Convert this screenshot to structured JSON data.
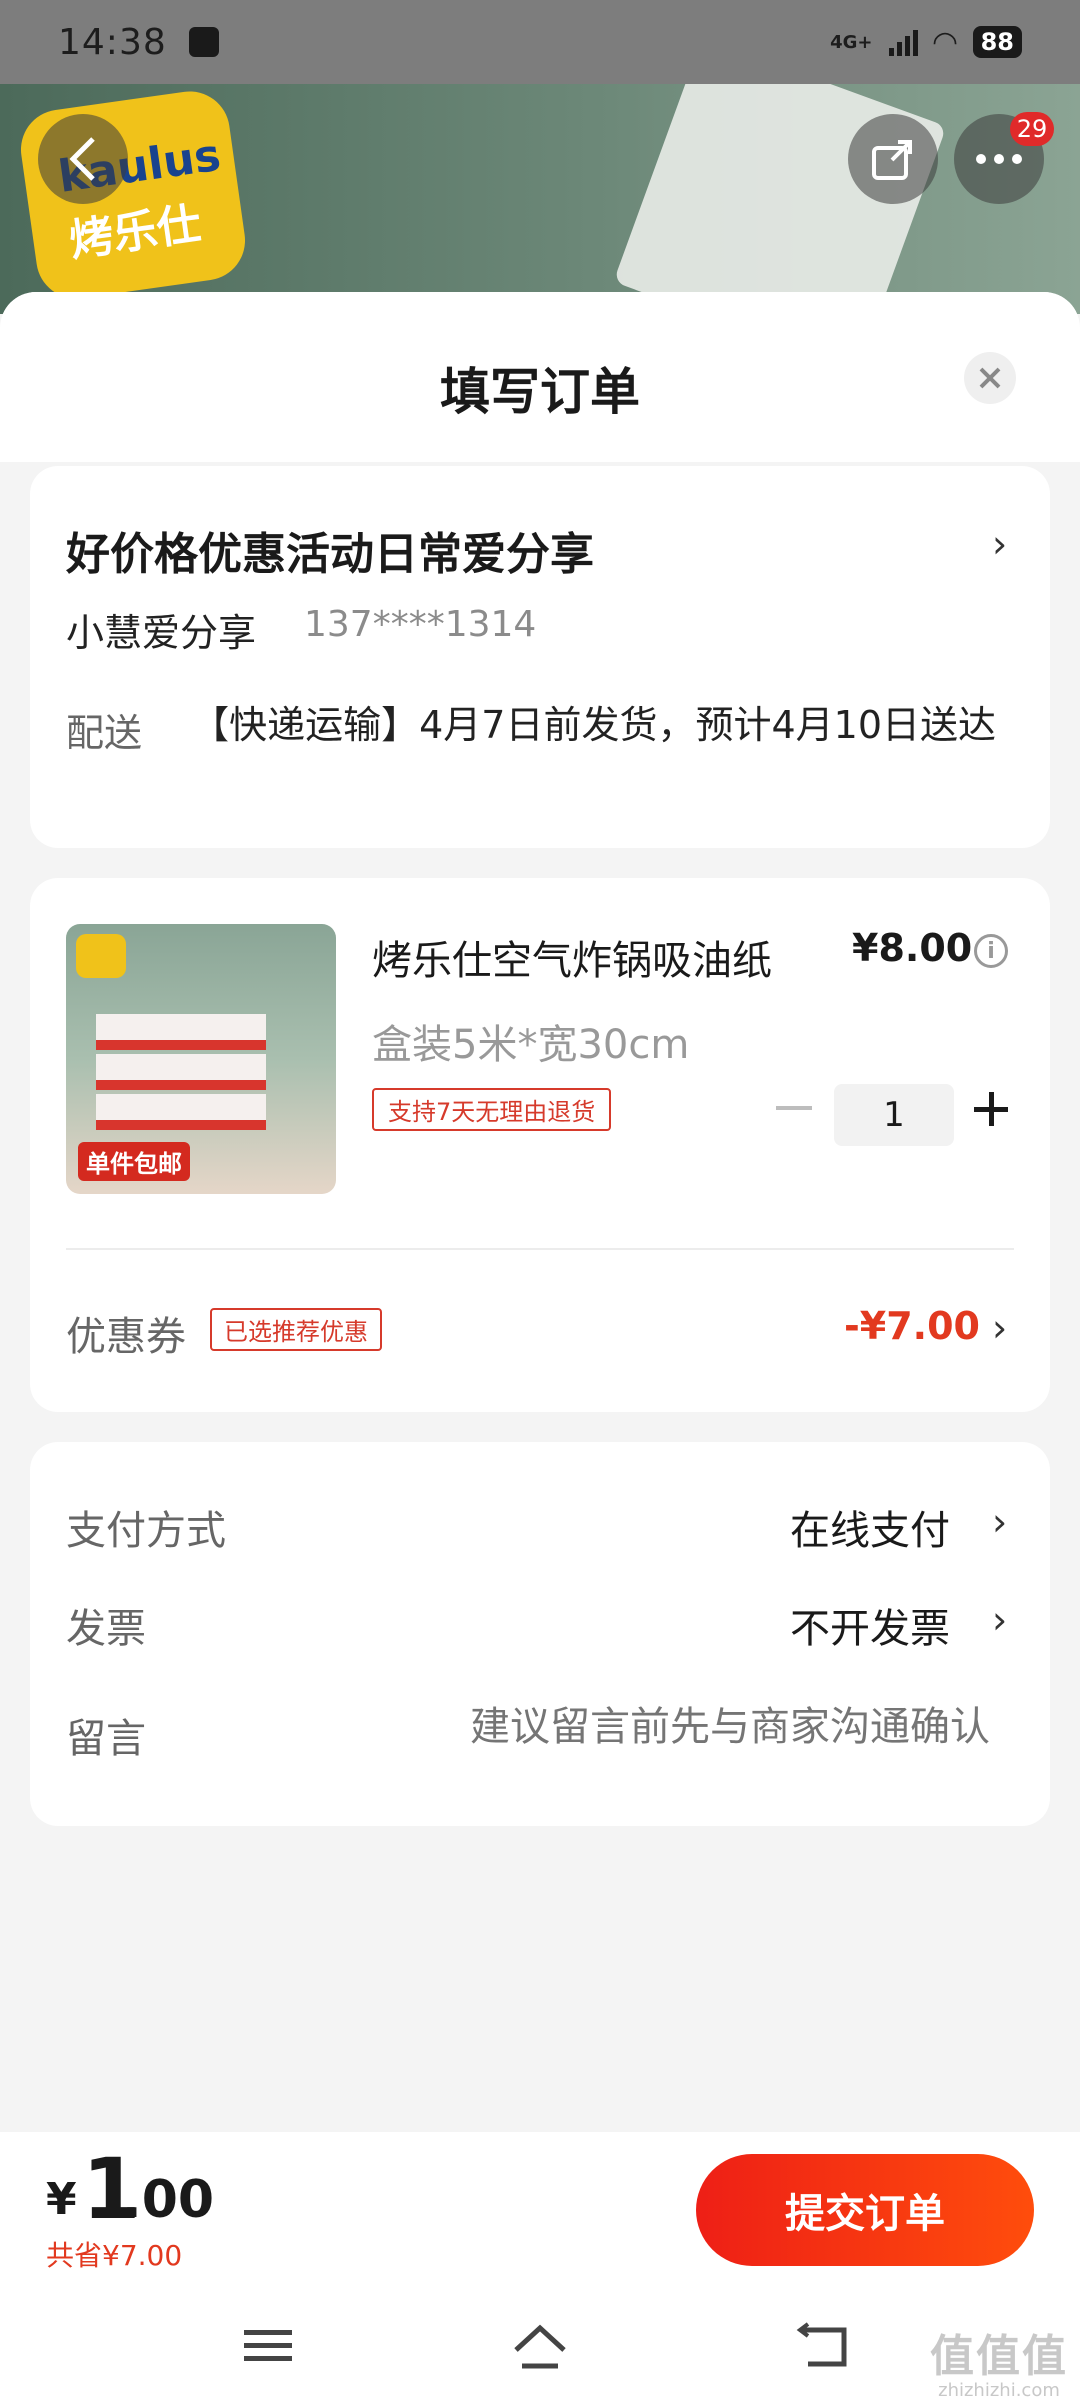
{
  "status_bar": {
    "time": "14:38",
    "network": "4G+",
    "battery": "88"
  },
  "header": {
    "badge_count": "29",
    "logo_en": "kaulus",
    "logo_cn": "烤乐仕"
  },
  "sheet": {
    "title": "填写订单"
  },
  "address": {
    "title": "好价格优惠活动日常爱分享",
    "name": "小慧爱分享",
    "phone": "137****1314",
    "shipping_label": "配送",
    "shipping_text": "【快递运输】4月7日前发货，预计4月10日送达"
  },
  "product": {
    "name": "烤乐仕空气炸锅吸油纸",
    "price": "¥8.00",
    "spec": "盒装5米*宽30cm",
    "return_tag": "支持7天无理由退货",
    "quantity": "1",
    "image_tag": "单件包邮"
  },
  "coupon": {
    "label": "优惠券",
    "tag": "已选推荐优惠",
    "value": "-¥7.00"
  },
  "payment": {
    "method_label": "支付方式",
    "method_value": "在线支付",
    "invoice_label": "发票",
    "invoice_value": "不开发票",
    "message_label": "留言",
    "message_placeholder": "建议留言前先与商家沟通确认"
  },
  "footer": {
    "currency": "¥",
    "total_int": "1",
    "total_dec": ".00",
    "saved": "共省¥7.00",
    "submit": "提交订单"
  },
  "watermark": {
    "big": "值值值",
    "small": "zhizhizhi.com"
  }
}
